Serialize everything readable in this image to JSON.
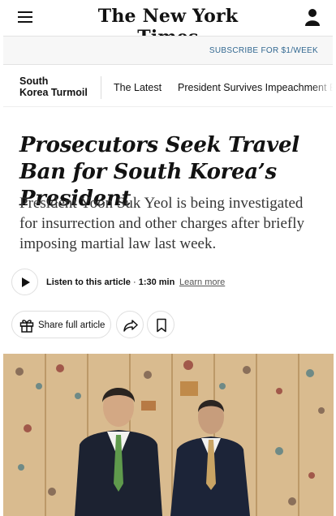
{
  "header": {
    "masthead": "The New York Times",
    "menu_icon": "hamburger-menu-icon",
    "account_icon": "user-account-icon"
  },
  "subscribe": {
    "label": "SUBSCRIBE FOR $1/WEEK"
  },
  "section_nav": {
    "section_name_line1": "South",
    "section_name_line2": "Korea Turmoil",
    "links": [
      "The Latest",
      "President Survives Impeachment B"
    ]
  },
  "article": {
    "headline": "Prosecutors Seek Travel Ban for South Korea’s President",
    "summary": "President Yoon Suk Yeol is being investigated for insurrection and other charges after briefly imposing martial law last week."
  },
  "audio": {
    "label": "Listen to this article",
    "separator": " · ",
    "duration": "1:30 min",
    "learn_more": "Learn more",
    "play_icon": "play-icon"
  },
  "share": {
    "share_label": "Share full article",
    "gift_icon": "gift-icon",
    "forward_icon": "share-arrow-icon",
    "bookmark_icon": "bookmark-icon"
  },
  "colors": {
    "link_blue": "#326891",
    "text": "#121212",
    "photo_background": "#d8b98c"
  }
}
